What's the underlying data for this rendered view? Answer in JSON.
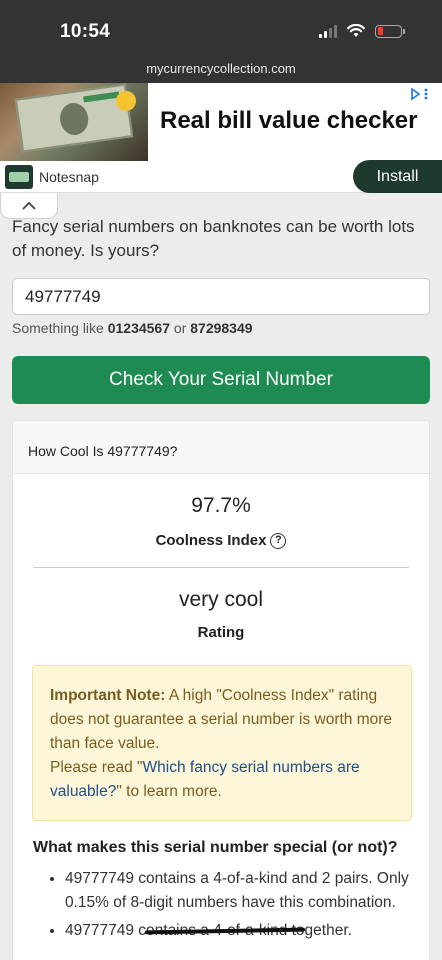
{
  "status": {
    "time": "10:54"
  },
  "browser": {
    "url": "mycurrencycollection.com"
  },
  "ad": {
    "title": "Real bill value checker",
    "choice_icon": "adchoices-icon",
    "app_name": "Notesnap",
    "install_label": "Install"
  },
  "intro": {
    "text": "Fancy serial numbers on banknotes can be worth lots of money. Is yours?"
  },
  "search": {
    "value": "49777749",
    "hint_prefix": "Something like",
    "example1": "01234567",
    "or_word": "or",
    "example2": "87298349"
  },
  "check_button": {
    "label": "Check Your Serial Number"
  },
  "result": {
    "header": "How Cool Is 49777749?",
    "coolness_value": "97.7%",
    "coolness_label": "Coolness Index",
    "rating_value": "very cool",
    "rating_label": "Rating"
  },
  "note": {
    "title": "Important Note:",
    "body": "A high \"Coolness Index\" rating does not guarantee a serial number is worth more than face value.",
    "read_prefix": "Please read \"",
    "link_text": "Which fancy serial numbers are valuable?",
    "read_suffix": "\" to learn more."
  },
  "special": {
    "heading": "What makes this serial number special (or not)?",
    "items": [
      "49777749 contains a 4-of-a-kind and 2 pairs. Only 0.15% of 8-digit numbers have this combination.",
      "49777749 contains a 4-of-a-kind together."
    ]
  }
}
